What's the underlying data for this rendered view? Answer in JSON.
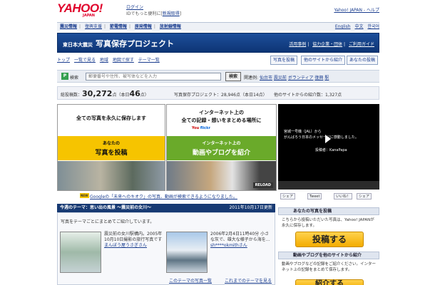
{
  "header": {
    "logo": "YAHOO!",
    "logo_sub": "JAPAN",
    "login": "ログイン",
    "login_sub_prefix": "IDでもっと便利に[",
    "register": "新規取得",
    "login_sub_suffix": "]",
    "top_links": "Yahoo! JAPAN - ヘルプ"
  },
  "service_bar": {
    "items": [
      "震災情報",
      "復興支援",
      "節電情報",
      "原発情報",
      "放射線情報"
    ],
    "languages": [
      "English",
      "中文",
      "한국어"
    ]
  },
  "banner": {
    "prefix": "東日本大震災",
    "title": "写真保存プロジェクト",
    "links": [
      "活用事例",
      "協力企業・団体",
      "ご利用ガイド"
    ]
  },
  "nav": {
    "items": [
      "トップ",
      "一覧で見る",
      "地域",
      "地図で探す",
      "テーマ一覧"
    ],
    "buttons": [
      "写真を投稿",
      "他のサイトから紹介",
      "あなたの投稿"
    ]
  },
  "search": {
    "label": "検索",
    "placeholder": "郵便番号や住所、被写体などを入力",
    "button": "検索",
    "keywords_label": "関連例:",
    "keywords": [
      "仙台市",
      "震災前",
      "ボランティア",
      "復興",
      "駅"
    ]
  },
  "stats": {
    "total_label": "総投稿数：",
    "total": "30,272",
    "total_unit": "点（本日",
    "today": "46",
    "today_unit": "点）",
    "project": "写真保存プロジェクト：28,946点（本日14点）",
    "other": "他のサイトからの紹介数：1,327点"
  },
  "promo": {
    "left_heading": "全ての写真を永久に保存します",
    "left_small": "あなたの",
    "left_big": "写真を投稿",
    "right_heading1": "インターネット上の",
    "right_heading2": "全ての記録・想いをまとめる場所に",
    "right_small": "インターネット上の",
    "right_big": "動画やブログを紹介",
    "reload": "RELOAD"
  },
  "video": {
    "line1": "宮城一号機（JAL）から",
    "line2": "がんばろう日本のメッセージに感動しました。",
    "poster": "投稿者：KanaPapa"
  },
  "share": [
    "シェア",
    "Tweet",
    "いいね！",
    "シェア"
  ],
  "news": {
    "badge": "NEW",
    "text": "Googleの「未来へのキオク」の写真、動画が検索できるようになりました。"
  },
  "theme": {
    "header": "今週のテーマ：思い出の風景 ～震災前の女川～",
    "date": "2011年10月17日更新",
    "intro": "写真をテーマごとにまとめてご紹介しています。",
    "cards": [
      {
        "text": "震災前の女川駅構内。2005年10月10日撮影の旅行写真です",
        "user": "まんぼう屋うさぎさん"
      },
      {
        "text": "2006年2月4日11時40分 小さな灰で、雄大な様子から海を...",
        "user": "sh****okmithさん"
      }
    ],
    "more1": "このテーマの写真一覧",
    "more2": "これまでのテーマを見る"
  },
  "right": {
    "post_head": "あなたの写真を投稿",
    "post_text": "こちらから投稿いただいた写真は、Yahoo! JAPANが永久に保存します。",
    "post_button": "投稿する",
    "intro_head": "動画やブログを他のサイトから紹介",
    "intro_text": "動画やブログなどの記録をご紹介ください。インターネット上の記録をまとめて保存します。",
    "intro_button": "紹介する"
  },
  "colors": {
    "brand_red": "#e0002a",
    "navy": "#173a73",
    "yellow": "#f6c400",
    "green": "#6aaa2a"
  }
}
